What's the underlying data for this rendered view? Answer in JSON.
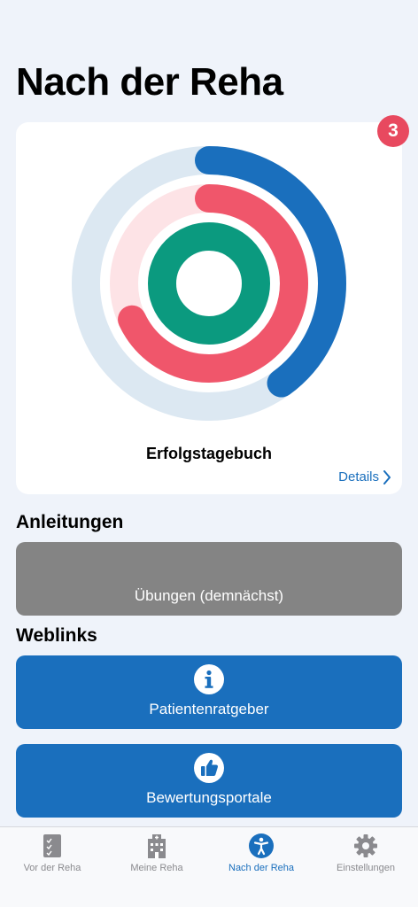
{
  "page": {
    "title": "Nach der Reha"
  },
  "card": {
    "badge": "3",
    "title": "Erfolgstagebuch",
    "details_label": "Details",
    "rings": [
      {
        "name": "outer",
        "progress": 0.4,
        "color": "#1a6fbd",
        "track": "#dce8f2"
      },
      {
        "name": "middle",
        "progress": 0.68,
        "color": "#f0566b",
        "track": "#fde3e6"
      },
      {
        "name": "inner",
        "progress": 1.0,
        "color": "#0b9a7f",
        "track": "#0b9a7f"
      }
    ]
  },
  "sections": {
    "anleitungen": "Anleitungen",
    "weblinks": "Weblinks"
  },
  "tiles": {
    "uebungen": "Übungen (demnächst)",
    "patientenratgeber": "Patientenratgeber",
    "bewertungsportale": "Bewertungsportale"
  },
  "tabs": [
    {
      "label": "Vor der Reha",
      "icon": "checklist-icon",
      "active": false
    },
    {
      "label": "Meine Reha",
      "icon": "hospital-icon",
      "active": false
    },
    {
      "label": "Nach der Reha",
      "icon": "accessibility-icon",
      "active": true
    },
    {
      "label": "Einstellungen",
      "icon": "gear-icon",
      "active": false
    }
  ]
}
